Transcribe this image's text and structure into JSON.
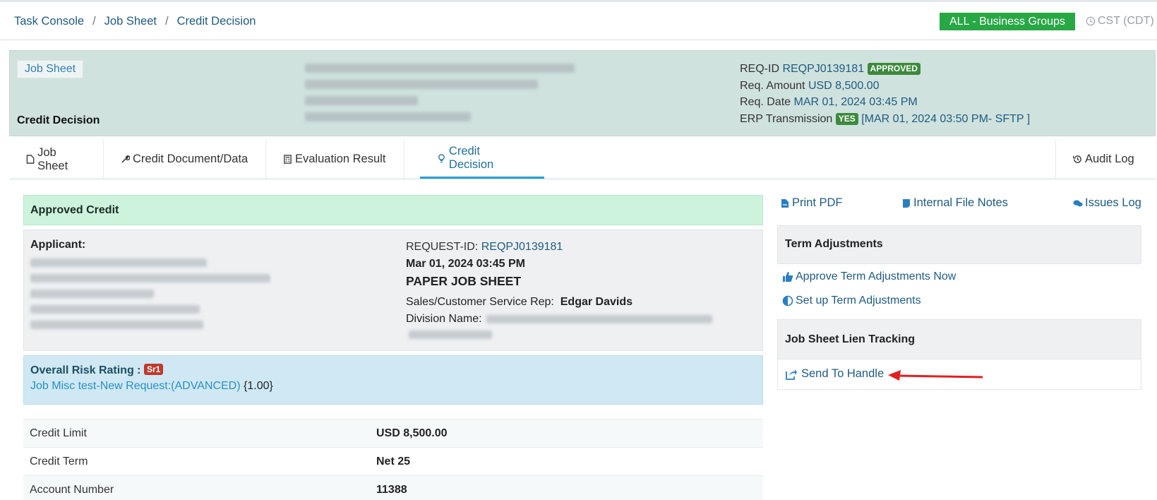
{
  "breadcrumb": {
    "items": [
      "Task Console",
      "Job Sheet",
      "Credit Decision"
    ],
    "separator": "/"
  },
  "header_right": {
    "business_group": "ALL - Business Groups",
    "timezone": "CST (CDT)"
  },
  "job_header": {
    "job_sheet_label": "Job Sheet",
    "credit_decision_label": "Credit Decision",
    "req_id_label": "REQ-ID",
    "req_id_value": "REQPJ0139181",
    "status_badge": "APPROVED",
    "amount_label": "Req. Amount",
    "amount_value": "USD 8,500.00",
    "date_label": "Req. Date",
    "date_value": "MAR 01, 2024 03:45 PM",
    "erp_label": "ERP Transmission",
    "erp_badge": "YES",
    "erp_value": "[MAR 01, 2024 03:50 PM- SFTP ]"
  },
  "tabs": [
    {
      "label": "Job Sheet",
      "icon": "file-icon"
    },
    {
      "label": "Credit Document/Data",
      "icon": "wrench-icon"
    },
    {
      "label": "Evaluation Result",
      "icon": "calculator-icon"
    },
    {
      "label": "Credit Decision",
      "icon": "lightbulb-icon",
      "active": true
    },
    {
      "label": "Audit Log",
      "icon": "history-icon"
    }
  ],
  "main": {
    "approved_title": "Approved Credit",
    "applicant_label": "Applicant:",
    "request_id_label": "REQUEST-ID:",
    "request_id_value": "REQPJ0139181",
    "request_date": "Mar 01, 2024 03:45 PM",
    "sheet_type": "PAPER JOB SHEET",
    "rep_label": "Sales/Customer Service Rep:",
    "rep_value": "Edgar Davids",
    "division_label": "Division Name:",
    "risk_label": "Overall Risk Rating :",
    "risk_badge": "Sr1",
    "risk_link": "Job Misc test-New Request:(ADVANCED)",
    "risk_score": "{1.00}",
    "credit_rows": [
      {
        "label": "Credit Limit",
        "value": "USD 8,500.00"
      },
      {
        "label": "Credit Term",
        "value": "Net 25"
      },
      {
        "label": "Account Number",
        "value": "11388"
      }
    ]
  },
  "side": {
    "print_pdf": "Print PDF",
    "internal_notes": "Internal File Notes",
    "issues_log": "Issues Log",
    "term_adjustments_title": "Term Adjustments",
    "approve_now": "Approve Term Adjustments Now",
    "setup_term": "Set up Term Adjustments",
    "lien_title": "Job Sheet Lien Tracking",
    "send_to_handle": "Send To Handle"
  },
  "colors": {
    "link": "#1f5b80",
    "business_badge": "#28a745",
    "approved_bg": "#cdf3dd",
    "risk_bg": "#cfe8f3",
    "header_bg": "#cfe2de",
    "arrow": "#e02020"
  }
}
